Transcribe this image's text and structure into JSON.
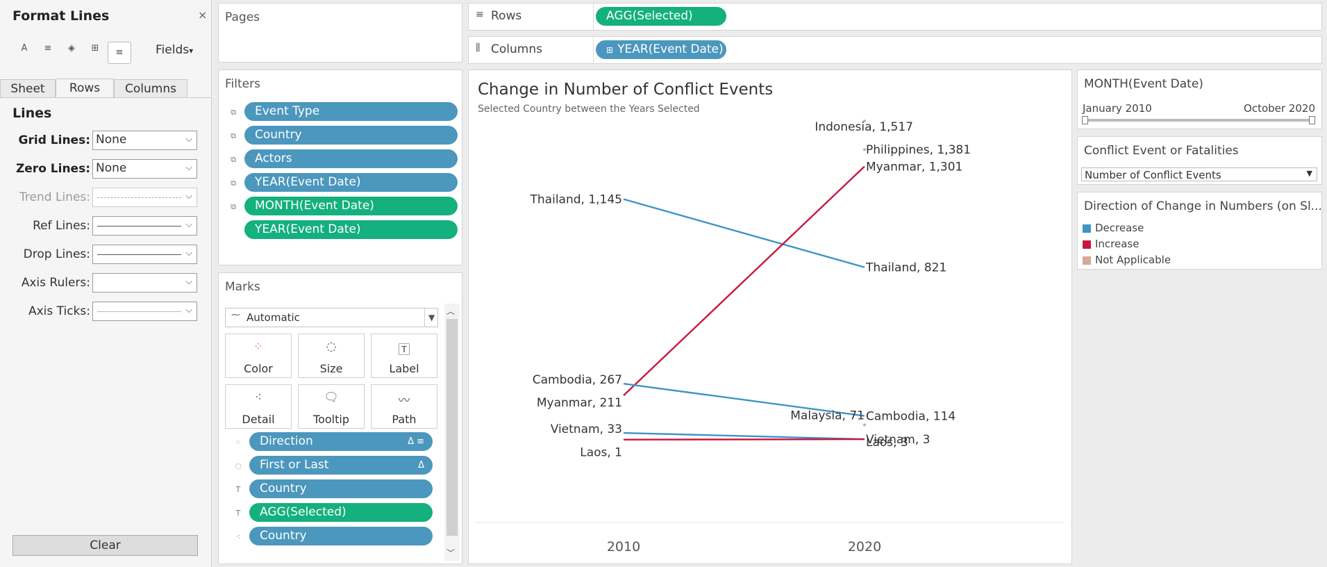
{
  "format_panel": {
    "title": "Format Lines",
    "close": "×",
    "toolbar": {
      "icons": [
        "font-icon",
        "align-icon",
        "shading-icon",
        "borders-icon",
        "lines-icon"
      ],
      "fields_label": "Fields",
      "fields_arrow": "▾"
    },
    "tabs": [
      "Sheet",
      "Rows",
      "Columns"
    ],
    "selected_tab": "Rows",
    "section_title": "Lines",
    "rows": [
      {
        "label": "Grid Lines:",
        "value": "None"
      },
      {
        "label": "Zero Lines:",
        "value": "None"
      },
      {
        "label": "Trend Lines:",
        "value": ""
      },
      {
        "label": "Ref Lines:",
        "value": ""
      },
      {
        "label": "Drop Lines:",
        "value": ""
      },
      {
        "label": "Axis Rulers:",
        "value": ""
      },
      {
        "label": "Axis Ticks:",
        "value": ""
      }
    ],
    "clear_label": "Clear"
  },
  "pages": {
    "title": "Pages"
  },
  "filters": {
    "title": "Filters",
    "items": [
      "Event Type",
      "Country",
      "Actors",
      "YEAR(Event Date)",
      "MONTH(Event Date)",
      "YEAR(Event Date)"
    ]
  },
  "marks": {
    "title": "Marks",
    "type": "Automatic",
    "buttons": [
      "Color",
      "Size",
      "Label",
      "Detail",
      "Tooltip",
      "Path"
    ],
    "fields": [
      {
        "name": "Direction",
        "suffix": "Δ ≡"
      },
      {
        "name": "First or Last",
        "suffix": "Δ"
      },
      {
        "name": "Country",
        "suffix": ""
      },
      {
        "name": "AGG(Selected)",
        "suffix": ""
      },
      {
        "name": "Country",
        "suffix": ""
      }
    ]
  },
  "shelves": {
    "rows_label": "Rows",
    "rows_pill": "AGG(Selected)",
    "columns_label": "Columns",
    "columns_pill": "YEAR(Event Date)"
  },
  "chart_data": {
    "type": "line",
    "title": "Change in Number of Conflict Events",
    "subtitle": "Selected Country between the Years Selected",
    "x": [
      "2010",
      "2020"
    ],
    "series": [
      {
        "name": "Thailand",
        "values": [
          1145,
          821
        ],
        "direction": "Decrease"
      },
      {
        "name": "Myanmar",
        "values": [
          211,
          1301
        ],
        "direction": "Increase"
      },
      {
        "name": "Cambodia",
        "values": [
          267,
          114
        ],
        "direction": "Decrease"
      },
      {
        "name": "Vietnam",
        "values": [
          33,
          3
        ],
        "direction": "Decrease"
      },
      {
        "name": "Laos",
        "values": [
          1,
          3
        ],
        "direction": "Increase"
      },
      {
        "name": "Indonesia",
        "values": [
          null,
          1517
        ],
        "direction": "Not Applicable"
      },
      {
        "name": "Philippines",
        "values": [
          null,
          1381
        ],
        "direction": "Not Applicable"
      },
      {
        "name": "Malaysia",
        "values": [
          null,
          71
        ],
        "direction": "Not Applicable"
      }
    ],
    "labels": {
      "2010": [
        "Thailand, 1,145",
        "Cambodia, 267",
        "Myanmar, 211",
        "Vietnam, 33",
        "Laos, 1"
      ],
      "2020": [
        "Indonesia, 1,517",
        "Philippines, 1,381",
        "Myanmar, 1,301",
        "Thailand, 821",
        "Cambodia, 114",
        "Malaysia, 71",
        "Laos, 3"
      ]
    },
    "ylim": [
      0,
      1600
    ],
    "grid": false,
    "colors": {
      "Decrease": "#3d94c6",
      "Increase": "#c8173f",
      "Not Applicable": "#d5a899"
    }
  },
  "legends": {
    "month": {
      "title": "MONTH(Event Date)",
      "start": "January 2010",
      "end": "October 2020"
    },
    "measure": {
      "title": "Conflict Event or Fatalities",
      "value": "Number of Conflict Events"
    },
    "direction": {
      "title": "Direction of Change in Numbers (on Sl...",
      "items": [
        {
          "label": "Decrease",
          "color": "#3d94c6"
        },
        {
          "label": "Increase",
          "color": "#c8173f"
        },
        {
          "label": "Not Applicable",
          "color": "#d5a899"
        }
      ]
    }
  }
}
